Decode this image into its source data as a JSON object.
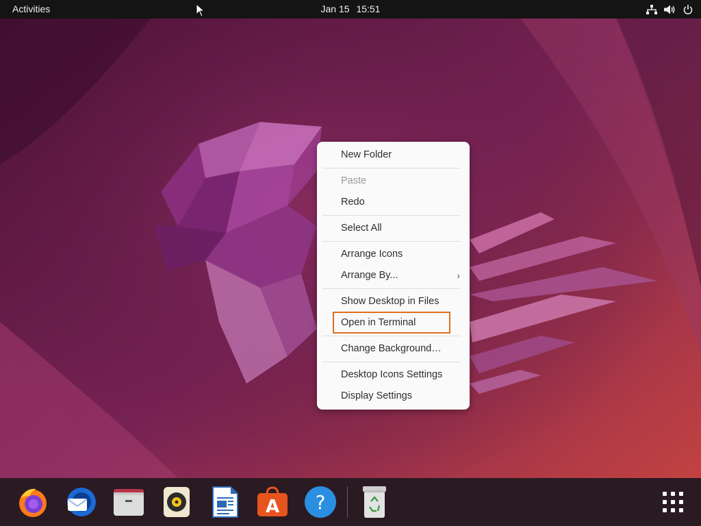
{
  "topbar": {
    "activities_label": "Activities",
    "date": "Jan 15",
    "time": "15:51",
    "tray_icons": [
      "network-icon",
      "volume-icon",
      "power-icon"
    ]
  },
  "context_menu": {
    "items": [
      {
        "label": "New Folder",
        "enabled": true
      },
      {
        "label": "Paste",
        "enabled": false
      },
      {
        "label": "Redo",
        "enabled": true
      },
      {
        "label": "Select All",
        "enabled": true
      },
      {
        "label": "Arrange Icons",
        "enabled": true
      },
      {
        "label": "Arrange By...",
        "enabled": true,
        "submenu": true
      },
      {
        "label": "Show Desktop in Files",
        "enabled": true
      },
      {
        "label": "Open in Terminal",
        "enabled": true,
        "highlighted": true
      },
      {
        "label": "Change Background…",
        "enabled": true
      },
      {
        "label": "Desktop Icons Settings",
        "enabled": true
      },
      {
        "label": "Display Settings",
        "enabled": true
      }
    ],
    "highlight_color": "#e06d1c"
  },
  "dock": {
    "apps": [
      {
        "name": "firefox",
        "icon": "firefox-icon"
      },
      {
        "name": "thunderbird",
        "icon": "thunderbird-icon"
      },
      {
        "name": "files",
        "icon": "files-icon"
      },
      {
        "name": "rhythmbox",
        "icon": "rhythmbox-icon"
      },
      {
        "name": "libreoffice-writer",
        "icon": "writer-icon"
      },
      {
        "name": "ubuntu-software",
        "icon": "software-icon"
      },
      {
        "name": "help",
        "icon": "help-icon"
      },
      {
        "name": "trash",
        "icon": "trash-icon"
      }
    ],
    "show_apps_icon": "app-grid-icon"
  },
  "colors": {
    "topbar_bg": "#141414",
    "dock_bg": "#2a1a22",
    "menu_bg": "#fafafa"
  }
}
